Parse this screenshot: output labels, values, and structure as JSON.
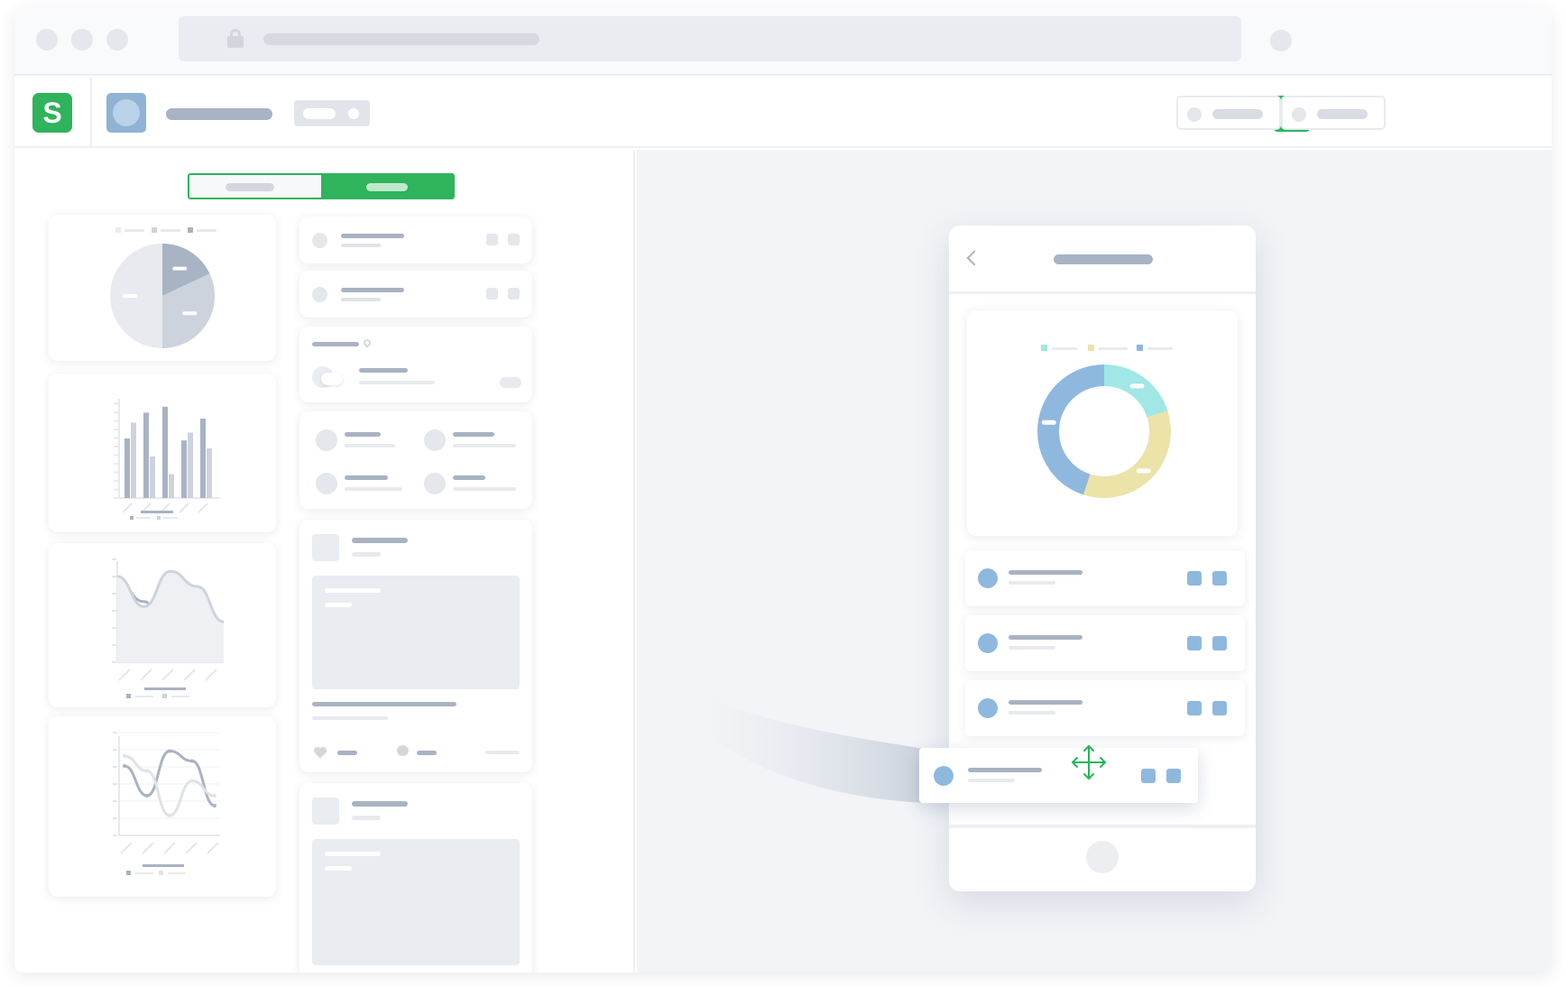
{
  "browser": {
    "window_controls": [
      "close-dot",
      "minimize-dot",
      "maximize-dot"
    ],
    "lock_icon": "lock-icon",
    "url": "",
    "extension_icon": "circle-icon"
  },
  "app": {
    "logo_text": "S",
    "logo_color": "#2fb35b",
    "project_name": "",
    "accent": "#24b659",
    "run_button_icon": "play-icon"
  },
  "left_panel": {
    "toggle": {
      "options": [
        "",
        ""
      ],
      "selected_index": 1
    },
    "widgets": [
      "pie-chart",
      "bar-chart",
      "area-chart",
      "line-chart"
    ],
    "list_cards": [
      "list-row",
      "list-row",
      "weather-card",
      "contacts-grid",
      "post-card",
      "post-card"
    ]
  },
  "phone": {
    "title": "",
    "donut_colors": [
      "#a0e7e5",
      "#ebe3a8",
      "#8fb8df"
    ],
    "rows": 3,
    "dragged_row": true,
    "drag_icon": "move-icon",
    "drag_color": "#24b659"
  },
  "chart_data": [
    {
      "type": "pie",
      "values": [
        18,
        32,
        50
      ],
      "colors": [
        "#a8b3c3",
        "#cdd3dd",
        "#e7eaee"
      ]
    },
    {
      "type": "bar",
      "series": [
        {
          "values": [
            60,
            86,
            92,
            58,
            80
          ]
        },
        {
          "values": [
            76,
            42,
            24,
            66,
            50
          ]
        }
      ]
    },
    {
      "type": "area",
      "series": [
        {
          "values": [
            80,
            60,
            20,
            70,
            30
          ]
        },
        {
          "values": [
            85,
            55,
            90,
            75,
            40
          ]
        }
      ]
    },
    {
      "type": "line",
      "series": [
        {
          "values": [
            70,
            40,
            85,
            75,
            30
          ]
        },
        {
          "values": [
            80,
            65,
            20,
            55,
            40
          ]
        }
      ]
    },
    {
      "type": "pie",
      "values": [
        20,
        35,
        45
      ],
      "colors": [
        "#a0e7e5",
        "#ebe3a8",
        "#8fb8df"
      ]
    }
  ]
}
